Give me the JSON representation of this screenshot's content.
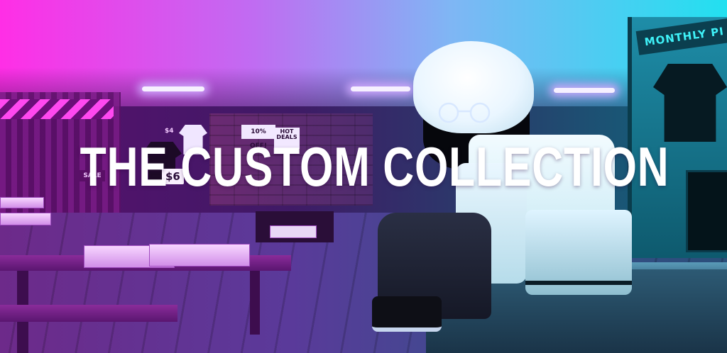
{
  "banner": {
    "title": "THE CUSTOM COLLECTION"
  },
  "store_signs": {
    "discount_poster": "10% OFF!",
    "hot_deals_poster": "HOT\nDEALS",
    "monthly_banner": "MONTHLY PI",
    "sale_sign": "SALE",
    "price_tag_1": "$6",
    "price_tag_2": "$4"
  },
  "colors": {
    "gradient_left": "#ff2ee6",
    "gradient_mid": "#8a3fe0",
    "gradient_right": "#14d6e6",
    "title_text": "#ffffff"
  }
}
